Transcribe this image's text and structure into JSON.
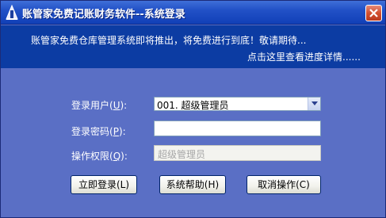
{
  "window": {
    "title": "账管家免费记账财务软件--系统登录",
    "close_glyph": "✕"
  },
  "banner": {
    "notice": "账管家免费仓库管理系统即将推出，将免费进行到底！敬请期待...",
    "link": "点击这里查看进度详情......"
  },
  "form": {
    "user_label": "登录用户",
    "user_key": "U",
    "user_value": "001. 超级管理员",
    "password_label": "登录密码",
    "password_key": "P",
    "password_value": "",
    "permission_label": "操作权限",
    "permission_key": "Q",
    "permission_value": "超级管理员"
  },
  "buttons": {
    "login": "立即登录(L)",
    "help": "系统帮助(H)",
    "cancel": "取消操作(C)"
  },
  "colors": {
    "body_bg": "#5a6fc5",
    "banner_bg": "#0c3ca3",
    "titlebar": "#2251c7"
  },
  "icons": {
    "app": "app-logo-icon",
    "close": "close-icon",
    "dropdown": "chevron-down-icon"
  }
}
